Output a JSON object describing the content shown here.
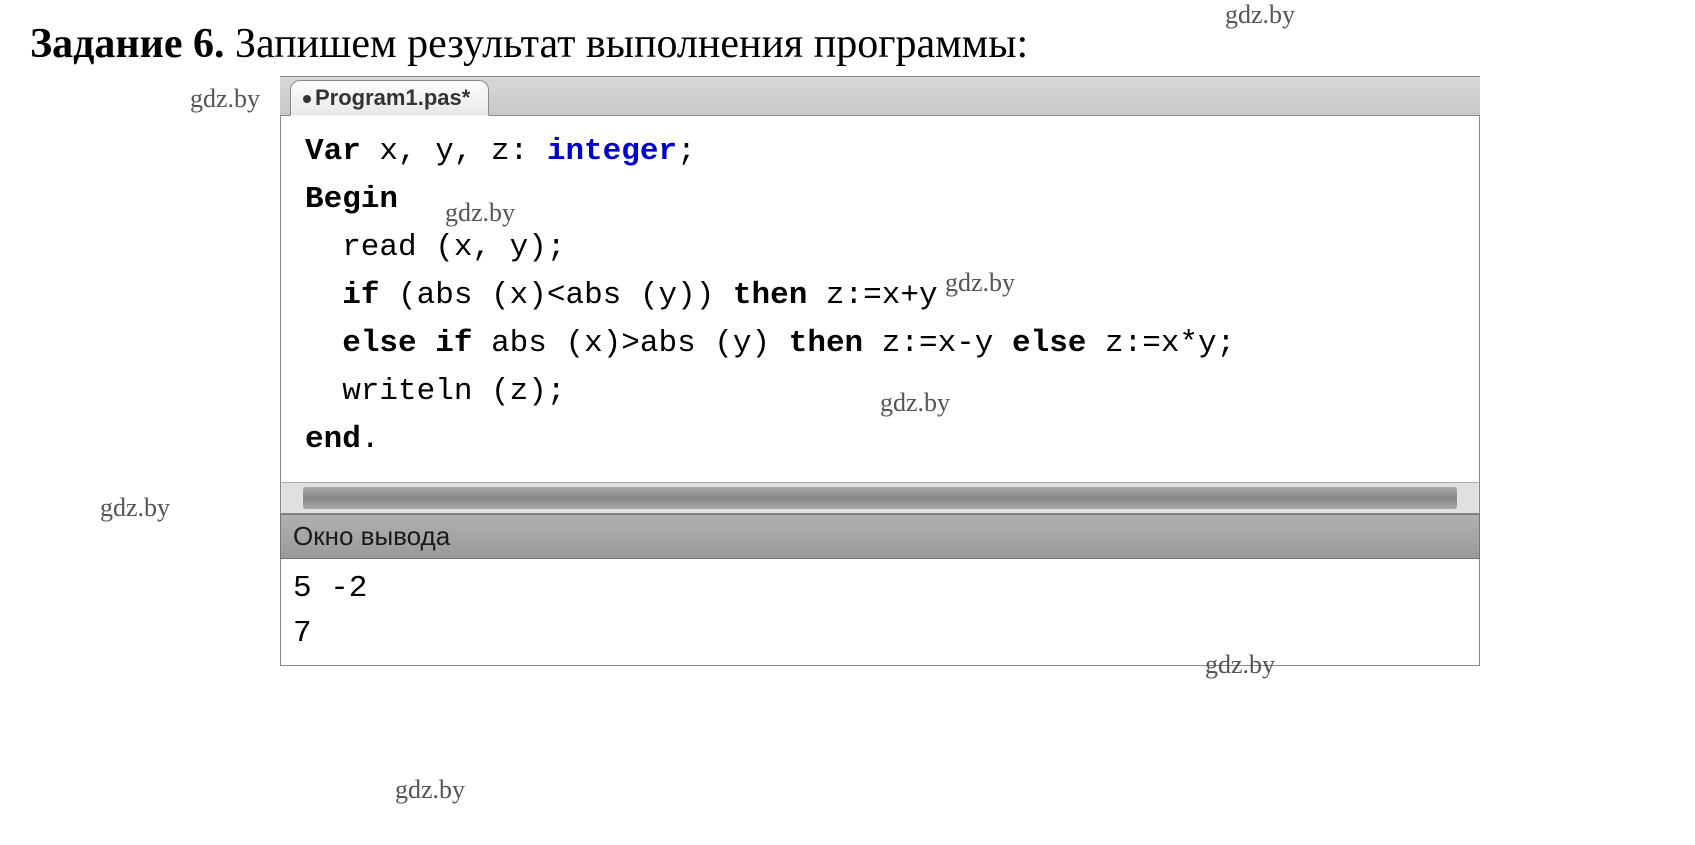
{
  "watermarks": {
    "w1": "gdz.by",
    "w2": "gdz.by",
    "w3": "gdz.by",
    "w4": "gdz.by",
    "w5": "gdz.by",
    "w6": "gdz.by",
    "w7": "gdz.by",
    "w8": "gdz.by"
  },
  "heading": {
    "bold": "Задание 6.",
    "rest": " Запишем результат выполнения программы:"
  },
  "ide": {
    "tab_label": "Program1.pas*",
    "code": {
      "var_kw": "Var",
      "var_vars": " x, y, z: ",
      "integer_kw": "integer",
      "semicolon": ";",
      "begin_kw": "Begin",
      "line_read": "  read (x, y);",
      "if_kw": "if",
      "cond1_part": " (abs (x)<abs (y)) ",
      "then_kw": "then",
      "assign1": " z:=x+y",
      "else_kw": "else",
      "cond2_part": " abs (x)>abs (y) ",
      "assign2": " z:=x-y ",
      "assign3": " z:=x*y;",
      "line_writeln": "  writeln (z);",
      "end_kw": "end",
      "end_dot": "."
    },
    "output_header": "Окно вывода",
    "output_lines": {
      "l1": "5 -2",
      "l2": "7"
    }
  }
}
